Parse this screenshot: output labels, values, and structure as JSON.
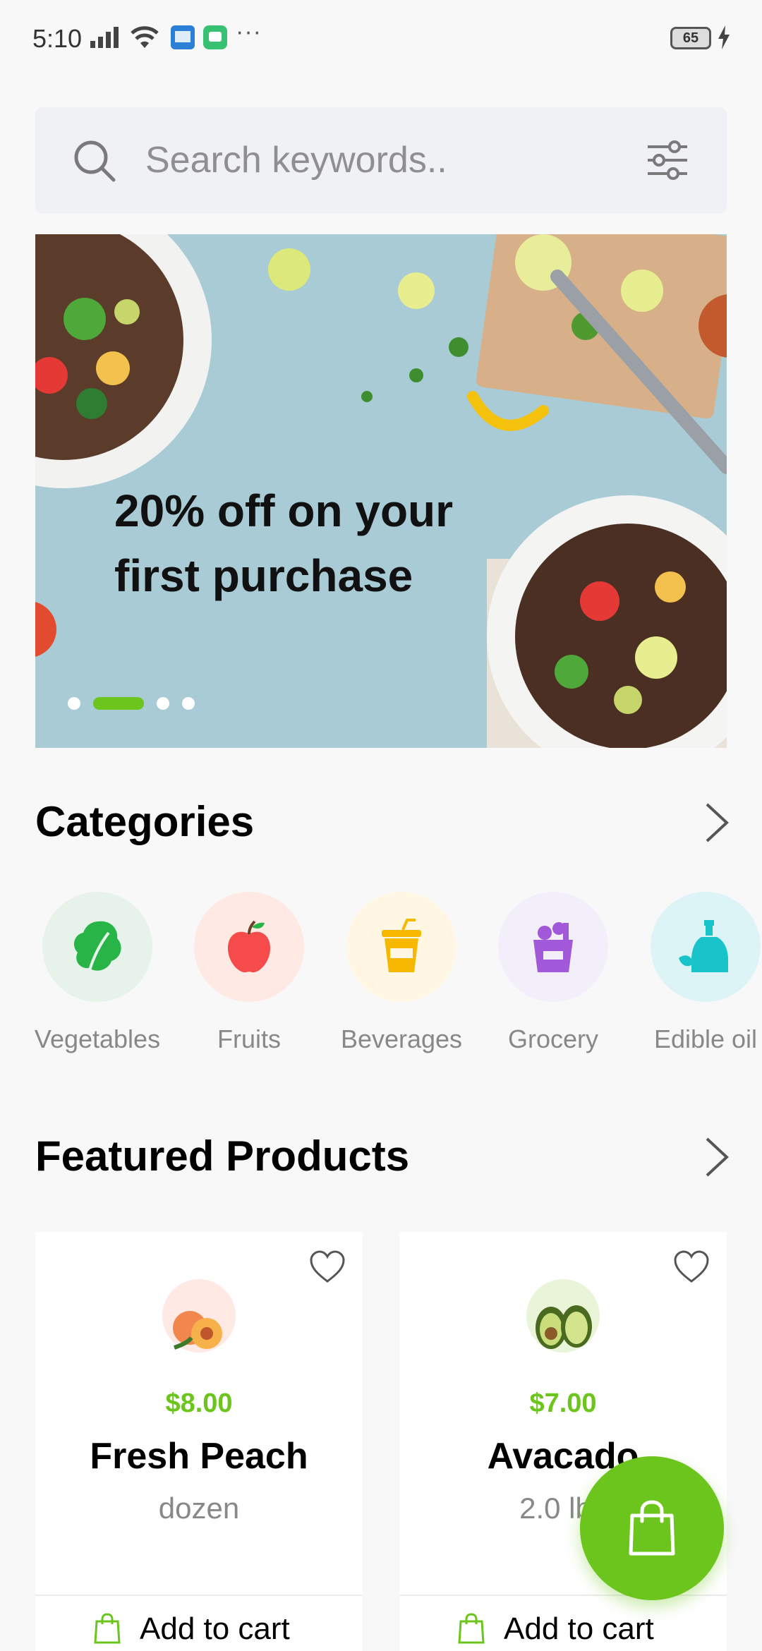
{
  "status_bar": {
    "time": "5:10",
    "battery": "65",
    "more": "···"
  },
  "search": {
    "placeholder": "Search keywords..",
    "icon": "search-icon",
    "filter_icon": "filter-icon"
  },
  "banner": {
    "text": "20% off on your first purchase",
    "slide_count": 4,
    "active_slide": 2
  },
  "categories": {
    "title": "Categories",
    "items": [
      {
        "label": "Vegetables",
        "icon": "vegetable-icon",
        "bg": "#E6F2EA",
        "color": "#28B446"
      },
      {
        "label": "Fruits",
        "icon": "apple-icon",
        "bg": "#FFE9E5",
        "color": "#F54B4B"
      },
      {
        "label": "Beverages",
        "icon": "beverage-icon",
        "bg": "#FFF6E3",
        "color": "#F7B801"
      },
      {
        "label": "Grocery",
        "icon": "grocery-icon",
        "bg": "#F3EFFA",
        "color": "#A259D9"
      },
      {
        "label": "Edible oil",
        "icon": "oil-bottle-icon",
        "bg": "#DCF4F5",
        "color": "#18C3C9"
      }
    ]
  },
  "featured": {
    "title": "Featured Products",
    "products": [
      {
        "price": "$8.00",
        "name": "Fresh Peach",
        "unit": "dozen",
        "add_label": "Add to cart",
        "img_bg": "#FFE9E5"
      },
      {
        "price": "$7.00",
        "name": "Avacado",
        "unit": "2.0 lbs",
        "add_label": "Add to cart",
        "img_bg": "#EAF4D9"
      }
    ]
  },
  "colors": {
    "accent": "#6CC51D",
    "muted_text": "#868889",
    "background": "#F8F8F9"
  },
  "fab": {
    "icon": "shopping-bag-icon"
  }
}
